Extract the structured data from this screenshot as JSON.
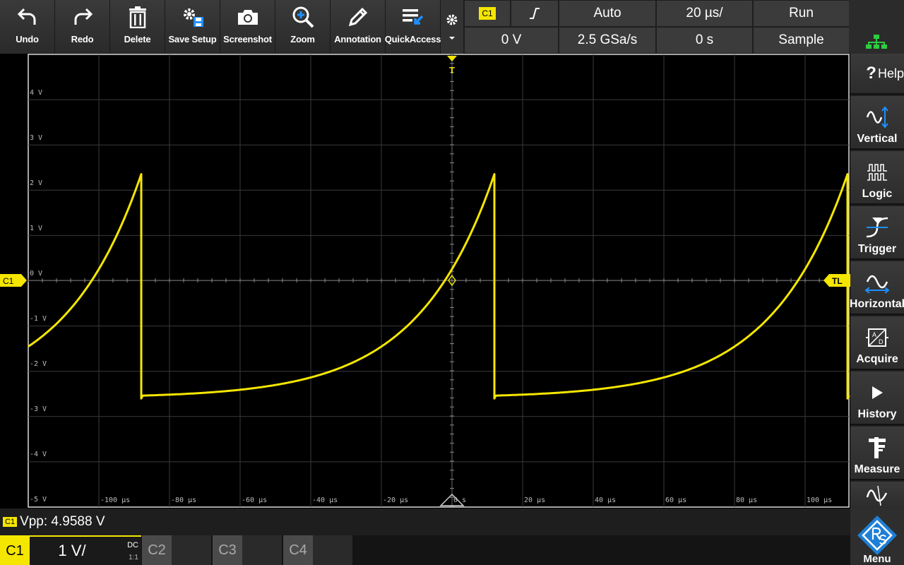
{
  "toolbar": {
    "undo": "Undo",
    "redo": "Redo",
    "delete": "Delete",
    "save_setup": "Save Setup",
    "screenshot": "Screenshot",
    "zoom": "Zoom",
    "annotation": "Annotation",
    "quick_access": "QuickAccess"
  },
  "status": {
    "channel": "C1",
    "trigger_level": "0 V",
    "trigger_mode": "Auto",
    "sample_rate": "2.5 GSa/s",
    "time_scale": "20 µs/",
    "time_offset": "0 s",
    "run_state": "Run",
    "acq_mode": "Sample"
  },
  "waveform": {
    "y_labels": [
      "4 V",
      "3 V",
      "2 V",
      "1 V",
      "0 V",
      "-1 V",
      "-2 V",
      "-3 V",
      "-4 V",
      "-5 V"
    ],
    "x_labels": [
      "-100 µs",
      "-80 µs",
      "-60 µs",
      "-40 µs",
      "-20 µs",
      "0 s",
      "20 µs",
      "40 µs",
      "60 µs",
      "80 µs",
      "100 µs"
    ],
    "channel_marker": "C1",
    "trigger_level_marker": "TL",
    "trigger_position_marker": "T",
    "trace_color": "#f5e600"
  },
  "side_menu": {
    "help": "Help",
    "vertical": "Vertical",
    "logic": "Logic",
    "trigger": "Trigger",
    "horizontal": "Horizontal",
    "acquire": "Acquire",
    "history": "History",
    "measure": "Measure",
    "menu": "Menu"
  },
  "measurement": {
    "channel": "C1",
    "text": "Vpp: 4.9588 V"
  },
  "channels": {
    "c1": {
      "label": "C1",
      "scale": "1 V/",
      "coupling": "DC",
      "probe": "1:1"
    },
    "c2": {
      "label": "C2"
    },
    "c3": {
      "label": "C3"
    },
    "c4": {
      "label": "C4"
    }
  },
  "colors": {
    "channel1": "#f5e600",
    "accent_blue": "#1e90ff",
    "network_green": "#2ecc40"
  }
}
